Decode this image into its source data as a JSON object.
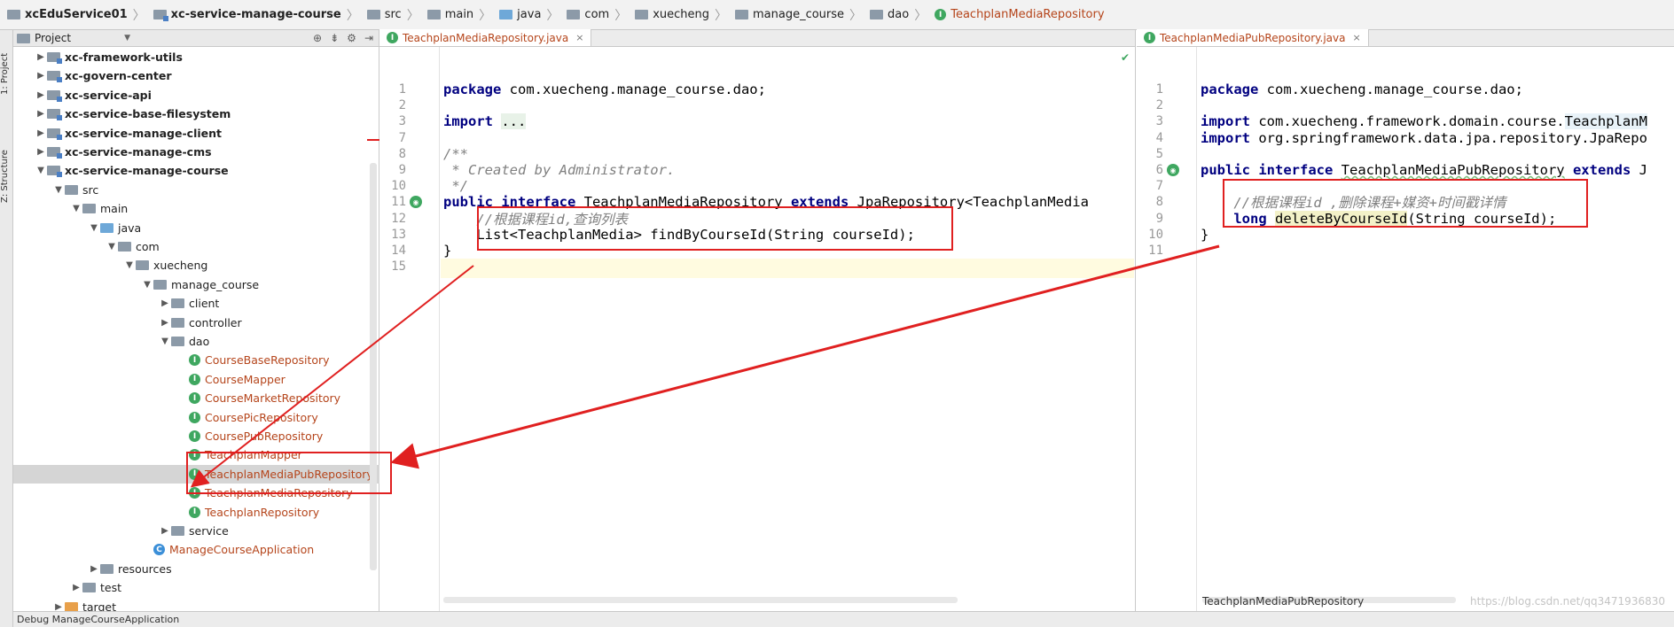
{
  "breadcrumb": [
    {
      "label": "xcEduService01",
      "icon": "folder-icon",
      "bold": true
    },
    {
      "label": "xc-service-manage-course",
      "icon": "module-icon",
      "bold": true
    },
    {
      "label": "src",
      "icon": "folder-icon"
    },
    {
      "label": "main",
      "icon": "folder-icon"
    },
    {
      "label": "java",
      "icon": "source-folder-icon"
    },
    {
      "label": "com",
      "icon": "package-icon"
    },
    {
      "label": "xuecheng",
      "icon": "package-icon"
    },
    {
      "label": "manage_course",
      "icon": "package-icon"
    },
    {
      "label": "dao",
      "icon": "package-icon"
    },
    {
      "label": "TeachplanMediaRepository",
      "icon": "interface-icon"
    }
  ],
  "tool_strip": {
    "project": "1: Project",
    "structure": "Z: Structure"
  },
  "project_panel": {
    "title": "Project",
    "tree": [
      {
        "label": "xc-framework-utils",
        "depth": 1,
        "arrow": "▶",
        "type": "module"
      },
      {
        "label": "xc-govern-center",
        "depth": 1,
        "arrow": "▶",
        "type": "module"
      },
      {
        "label": "xc-service-api",
        "depth": 1,
        "arrow": "▶",
        "type": "module"
      },
      {
        "label": "xc-service-base-filesystem",
        "depth": 1,
        "arrow": "▶",
        "type": "module"
      },
      {
        "label": "xc-service-manage-client",
        "depth": 1,
        "arrow": "▶",
        "type": "module"
      },
      {
        "label": "xc-service-manage-cms",
        "depth": 1,
        "arrow": "▶",
        "type": "module"
      },
      {
        "label": "xc-service-manage-course",
        "depth": 1,
        "arrow": "▼",
        "type": "module"
      },
      {
        "label": "src",
        "depth": 2,
        "arrow": "▼",
        "type": "folder"
      },
      {
        "label": "main",
        "depth": 3,
        "arrow": "▼",
        "type": "folder"
      },
      {
        "label": "java",
        "depth": 4,
        "arrow": "▼",
        "type": "source"
      },
      {
        "label": "com",
        "depth": 5,
        "arrow": "▼",
        "type": "package"
      },
      {
        "label": "xuecheng",
        "depth": 6,
        "arrow": "▼",
        "type": "package"
      },
      {
        "label": "manage_course",
        "depth": 7,
        "arrow": "▼",
        "type": "package"
      },
      {
        "label": "client",
        "depth": 8,
        "arrow": "▶",
        "type": "package"
      },
      {
        "label": "controller",
        "depth": 8,
        "arrow": "▶",
        "type": "package"
      },
      {
        "label": "dao",
        "depth": 8,
        "arrow": "▼",
        "type": "package"
      },
      {
        "label": "CourseBaseRepository",
        "depth": 9,
        "arrow": "",
        "type": "iface"
      },
      {
        "label": "CourseMapper",
        "depth": 9,
        "arrow": "",
        "type": "iface"
      },
      {
        "label": "CourseMarketRepository",
        "depth": 9,
        "arrow": "",
        "type": "iface"
      },
      {
        "label": "CoursePicRepository",
        "depth": 9,
        "arrow": "",
        "type": "iface"
      },
      {
        "label": "CoursePubRepository",
        "depth": 9,
        "arrow": "",
        "type": "iface"
      },
      {
        "label": "TeachplanMapper",
        "depth": 9,
        "arrow": "",
        "type": "iface"
      },
      {
        "label": "TeachplanMediaPubRepository",
        "depth": 9,
        "arrow": "",
        "type": "iface",
        "selected": true
      },
      {
        "label": "TeachplanMediaRepository",
        "depth": 9,
        "arrow": "",
        "type": "iface"
      },
      {
        "label": "TeachplanRepository",
        "depth": 9,
        "arrow": "",
        "type": "iface"
      },
      {
        "label": "service",
        "depth": 8,
        "arrow": "▶",
        "type": "package"
      },
      {
        "label": "ManageCourseApplication",
        "depth": 7,
        "arrow": "",
        "type": "class"
      },
      {
        "label": "resources",
        "depth": 4,
        "arrow": "▶",
        "type": "folder"
      },
      {
        "label": "test",
        "depth": 3,
        "arrow": "▶",
        "type": "folder"
      },
      {
        "label": "target",
        "depth": 2,
        "arrow": "▶",
        "type": "target"
      }
    ]
  },
  "bottom_bar": {
    "text": "Debug   ManageCourseApplication"
  },
  "editor_left": {
    "tab": "TeachplanMediaRepository.java",
    "lines": [
      {
        "n": "1",
        "html": "<span class=\"kw\">package</span> com.xuecheng.manage_course.dao;"
      },
      {
        "n": "2",
        "html": ""
      },
      {
        "n": "3",
        "html": "<span class=\"kw\">import</span> <span style=\"background:#e8f2e8\">...</span>"
      },
      {
        "n": "7",
        "html": ""
      },
      {
        "n": "8",
        "html": "<span class=\"cm\">/**</span>"
      },
      {
        "n": "9",
        "html": "<span class=\"cm\"> * Created by Administrator.</span>"
      },
      {
        "n": "10",
        "html": "<span class=\"cm\"> */</span>"
      },
      {
        "n": "11",
        "html": "<span class=\"kw\">public interface</span> TeachplanMediaRepository <span class=\"kw\">extends</span> JpaRepository&lt;TeachplanMedia"
      },
      {
        "n": "12",
        "html": "    <span class=\"cmt\">//根据课程id,查询列表</span>"
      },
      {
        "n": "13",
        "html": "    List&lt;TeachplanMedia&gt; findByCourseId(String courseId);"
      },
      {
        "n": "14",
        "html": "}"
      },
      {
        "n": "15",
        "html": ""
      }
    ]
  },
  "editor_right": {
    "tab": "TeachplanMediaPubRepository.java",
    "footer": "TeachplanMediaPubRepository",
    "watermark": "https://blog.csdn.net/qq3471936830",
    "lines": [
      {
        "n": "1",
        "html": "<span class=\"kw\">package</span> com.xuecheng.manage_course.dao;"
      },
      {
        "n": "2",
        "html": ""
      },
      {
        "n": "3",
        "html": "<span class=\"kw\">import</span> com.xuecheng.framework.domain.course.<span style=\"background:#e8f2f8\">TeachplanM</span>"
      },
      {
        "n": "4",
        "html": "<span class=\"kw\">import</span> org.springframework.data.jpa.repository.JpaRepo"
      },
      {
        "n": "5",
        "html": ""
      },
      {
        "n": "6",
        "html": "<span class=\"kw\">public interface</span> <span style=\"text-decoration:underline wavy #7fbf7f\">TeachplanMediaPubRepository</span> <span class=\"kw\">extends</span> J"
      },
      {
        "n": "7",
        "html": ""
      },
      {
        "n": "8",
        "html": "    <span class=\"cmt\">//根据课程id ,删除课程+媒资+时间戳详情</span>"
      },
      {
        "n": "9",
        "html": "    <span class=\"kw\">long</span> <span style=\"background:#f3f1c8\">deleteByCourseId</span>(String courseId);"
      },
      {
        "n": "10",
        "html": "}"
      },
      {
        "n": "11",
        "html": ""
      }
    ]
  },
  "colors": {
    "accent_red": "#e02020",
    "interface_text": "#b5451b",
    "keyword": "#000080"
  }
}
